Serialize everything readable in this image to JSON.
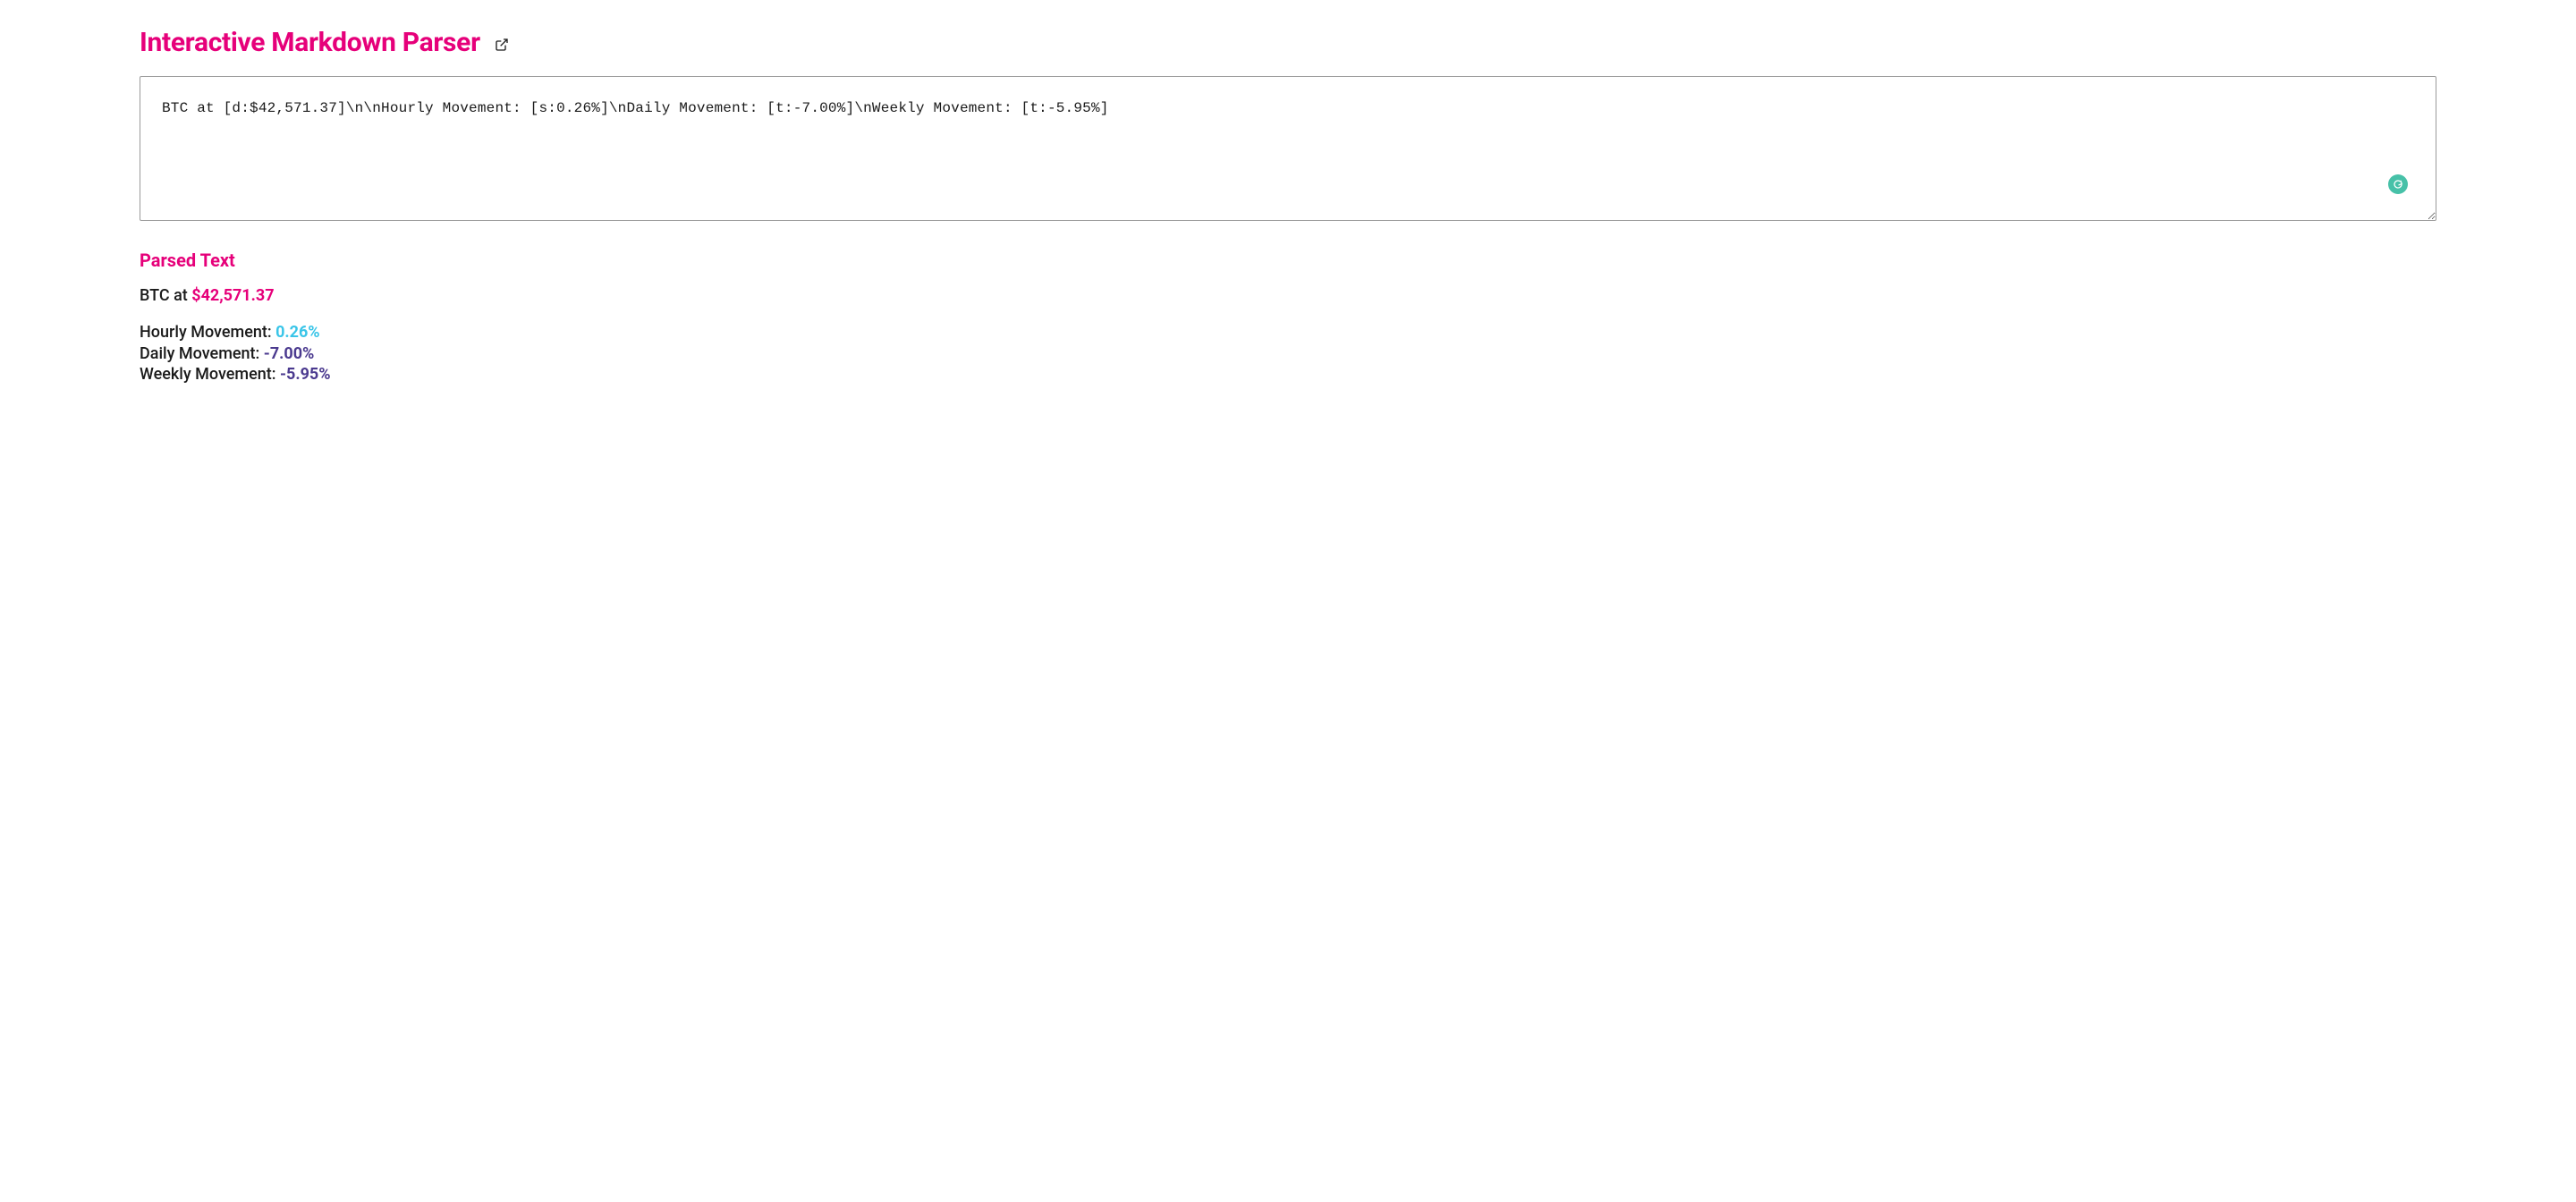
{
  "header": {
    "title": "Interactive Markdown Parser"
  },
  "input": {
    "value": "BTC at [d:$42,571.37]\\n\\nHourly Movement: [s:0.26%]\\nDaily Movement: [t:-7.00%]\\nWeekly Movement: [t:-5.95%]"
  },
  "parsed": {
    "section_title": "Parsed Text",
    "line1_prefix": "BTC at ",
    "line1_value": "$42,571.37",
    "line2_prefix": "Hourly Movement: ",
    "line2_value": "0.26%",
    "line3_prefix": "Daily Movement: ",
    "line3_value": "-7.00%",
    "line4_prefix": "Weekly Movement: ",
    "line4_value": "-5.95%"
  },
  "colors": {
    "accent_pink": "#e6007a",
    "stat_cyan": "#3ac5e8",
    "stat_purple": "#4b3a8f",
    "grammarly_green": "#47c1a8"
  }
}
